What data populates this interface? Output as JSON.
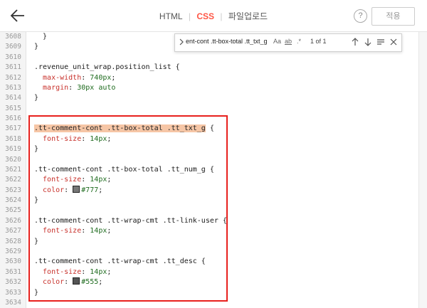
{
  "header": {
    "tabs": [
      {
        "label": "HTML",
        "active": false
      },
      {
        "label": "CSS",
        "active": true
      },
      {
        "label": "파일업로드",
        "active": false
      }
    ],
    "separators": [
      "|",
      "|"
    ],
    "help_label": "?",
    "apply_label": "적용"
  },
  "find": {
    "query": "ent-cont .tt-box-total .tt_txt_g",
    "match_case_label": "Aa",
    "whole_word_label": "ab",
    "regex_label": ".*",
    "count": "1 of 1",
    "icons": [
      "chevron-right-icon",
      "arrow-up-icon",
      "arrow-down-icon",
      "selection-icon",
      "close-icon"
    ]
  },
  "colors": {
    "accent": "#ff5544",
    "highlight_box": "#e8201d",
    "swatch_777": "#777777",
    "swatch_555": "#555555"
  },
  "code": {
    "lines": [
      {
        "n": "3608",
        "parts": [
          {
            "t": "  }",
            "c": "plain"
          }
        ]
      },
      {
        "n": "3609",
        "parts": [
          {
            "t": "}",
            "c": "plain"
          }
        ]
      },
      {
        "n": "3610",
        "parts": []
      },
      {
        "n": "3611",
        "parts": [
          {
            "t": ".revenue_unit_wrap.position_list {",
            "c": "sel"
          }
        ]
      },
      {
        "n": "3612",
        "parts": [
          {
            "t": "  max-width",
            "c": "prop"
          },
          {
            "t": ": ",
            "c": "plain"
          },
          {
            "t": "740px",
            "c": "val"
          },
          {
            "t": ";",
            "c": "plain"
          }
        ]
      },
      {
        "n": "3613",
        "parts": [
          {
            "t": "  margin",
            "c": "prop"
          },
          {
            "t": ": ",
            "c": "plain"
          },
          {
            "t": "30px auto",
            "c": "val"
          }
        ]
      },
      {
        "n": "3614",
        "parts": [
          {
            "t": "}",
            "c": "plain"
          }
        ]
      },
      {
        "n": "3615",
        "parts": []
      },
      {
        "n": "3616",
        "parts": []
      },
      {
        "n": "3617",
        "parts": [
          {
            "t": ".tt-comment-cont .tt-box-total .tt_txt_g",
            "c": "hl"
          },
          {
            "t": " {",
            "c": "plain"
          }
        ]
      },
      {
        "n": "3618",
        "parts": [
          {
            "t": "  font-size",
            "c": "prop"
          },
          {
            "t": ": ",
            "c": "plain"
          },
          {
            "t": "14px",
            "c": "val"
          },
          {
            "t": ";",
            "c": "plain"
          }
        ]
      },
      {
        "n": "3619",
        "parts": [
          {
            "t": "}",
            "c": "plain"
          }
        ]
      },
      {
        "n": "3620",
        "parts": []
      },
      {
        "n": "3621",
        "parts": [
          {
            "t": ".tt-comment-cont .tt-box-total .tt_num_g {",
            "c": "sel"
          }
        ]
      },
      {
        "n": "3622",
        "parts": [
          {
            "t": "  font-size",
            "c": "prop"
          },
          {
            "t": ": ",
            "c": "plain"
          },
          {
            "t": "14px",
            "c": "val"
          },
          {
            "t": ";",
            "c": "plain"
          }
        ]
      },
      {
        "n": "3623",
        "parts": [
          {
            "t": "  color",
            "c": "prop"
          },
          {
            "t": ": ",
            "c": "plain"
          },
          {
            "t": "",
            "c": "swatch",
            "color": "#777777"
          },
          {
            "t": "#777",
            "c": "val"
          },
          {
            "t": ";",
            "c": "plain"
          }
        ]
      },
      {
        "n": "3624",
        "parts": [
          {
            "t": "}",
            "c": "plain"
          }
        ]
      },
      {
        "n": "3625",
        "parts": []
      },
      {
        "n": "3626",
        "parts": [
          {
            "t": ".tt-comment-cont .tt-wrap-cmt .tt-link-user {",
            "c": "sel"
          }
        ]
      },
      {
        "n": "3627",
        "parts": [
          {
            "t": "  font-size",
            "c": "prop"
          },
          {
            "t": ": ",
            "c": "plain"
          },
          {
            "t": "14px",
            "c": "val"
          },
          {
            "t": ";",
            "c": "plain"
          }
        ]
      },
      {
        "n": "3628",
        "parts": [
          {
            "t": "}",
            "c": "plain"
          }
        ]
      },
      {
        "n": "3629",
        "parts": []
      },
      {
        "n": "3630",
        "parts": [
          {
            "t": ".tt-comment-cont .tt-wrap-cmt .tt_desc {",
            "c": "sel"
          }
        ]
      },
      {
        "n": "3631",
        "parts": [
          {
            "t": "  font-size",
            "c": "prop"
          },
          {
            "t": ": ",
            "c": "plain"
          },
          {
            "t": "14px",
            "c": "val"
          },
          {
            "t": ";",
            "c": "plain"
          }
        ]
      },
      {
        "n": "3632",
        "parts": [
          {
            "t": "  color",
            "c": "prop"
          },
          {
            "t": ": ",
            "c": "plain"
          },
          {
            "t": "",
            "c": "swatch",
            "color": "#555555"
          },
          {
            "t": "#555",
            "c": "val"
          },
          {
            "t": ";",
            "c": "plain"
          }
        ]
      },
      {
        "n": "3633",
        "parts": [
          {
            "t": "}",
            "c": "plain"
          }
        ]
      },
      {
        "n": "3634",
        "parts": []
      }
    ]
  }
}
